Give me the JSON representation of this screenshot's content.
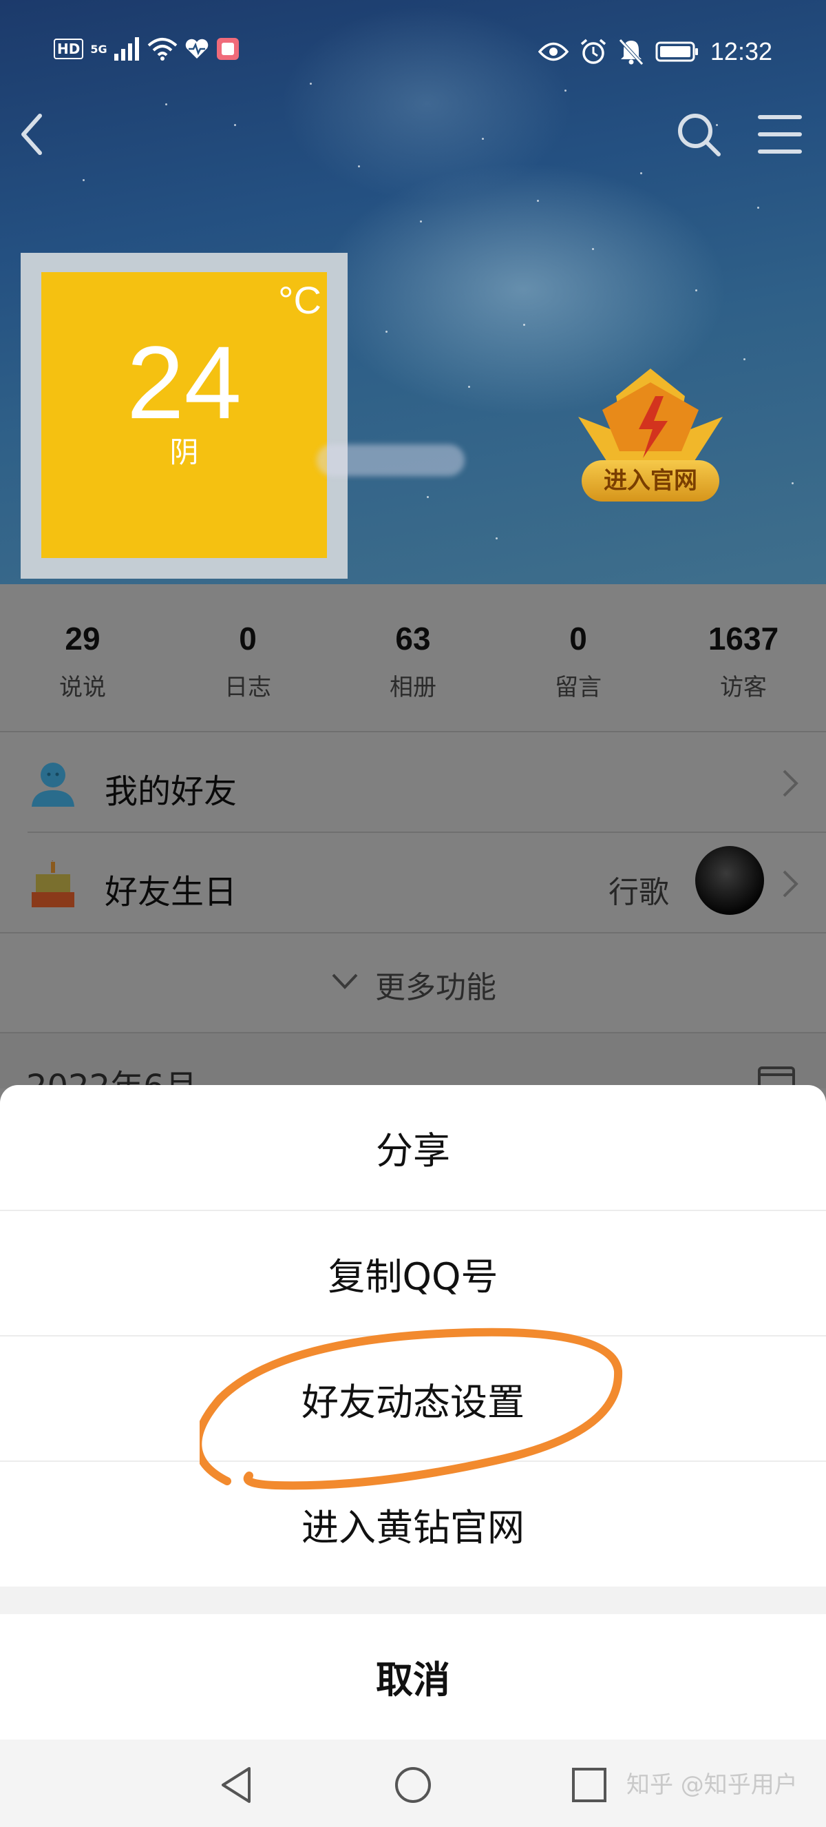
{
  "status_bar": {
    "network_badge": "HD",
    "signal_type": "5G",
    "time": "12:32",
    "icons": [
      "signal-icon",
      "wifi-icon",
      "health-icon",
      "app-notification-icon",
      "eye-icon",
      "alarm-icon",
      "mute-icon",
      "battery-icon"
    ]
  },
  "header": {
    "icons": [
      "back-icon",
      "search-icon",
      "menu-icon"
    ],
    "weather": {
      "temperature": "24",
      "unit": "°C",
      "condition": "阴"
    },
    "vip_button_label": "进入官网"
  },
  "stats": [
    {
      "value": "29",
      "label": "说说"
    },
    {
      "value": "0",
      "label": "日志"
    },
    {
      "value": "63",
      "label": "相册"
    },
    {
      "value": "0",
      "label": "留言"
    },
    {
      "value": "1637",
      "label": "访客"
    }
  ],
  "rows": {
    "friends": {
      "label": "我的好友",
      "icon": "person-icon"
    },
    "birthdays": {
      "label": "好友生日",
      "value": "行歌",
      "icon": "cake-icon"
    }
  },
  "more_functions_label": "更多功能",
  "date_header": "2022年6月",
  "action_sheet": {
    "items": [
      "分享",
      "复制QQ号",
      "好友动态设置",
      "进入黄钻官网"
    ],
    "cancel": "取消"
  },
  "navbar": {
    "icons": [
      "nav-back-icon",
      "nav-home-icon",
      "nav-recent-icon"
    ],
    "watermark": "知乎 @知乎用户"
  },
  "colors": {
    "weather_tile": "#f5c111",
    "annotation_stroke": "#f28a2e",
    "dim_overlay": "#808080"
  }
}
